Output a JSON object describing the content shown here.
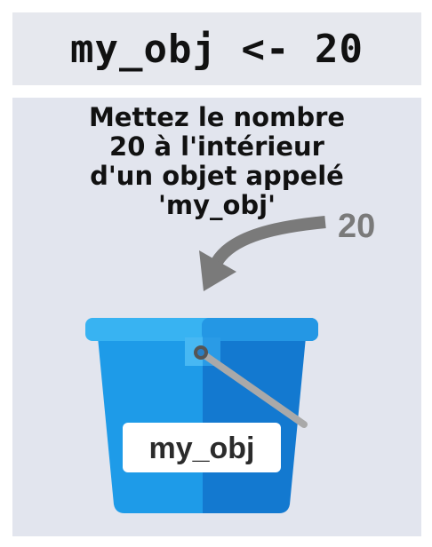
{
  "code": "my_obj <- 20",
  "caption": {
    "line1": "Mettez le nombre",
    "line2": "20 à l'intérieur",
    "line3": "d'un objet appelé",
    "line4": "'my_obj'"
  },
  "arrow_value": "20",
  "bucket_label": "my_obj",
  "colors": {
    "code_bg": "#e6e8ee",
    "panel_bg": "#e2e5ee",
    "arrow": "#7a7a7a",
    "bucket_light": "#1e9be8",
    "bucket_dark": "#1379d0",
    "bucket_rim": "#38b3f2",
    "handle": "#a9a9a9"
  },
  "icons": [
    "curved-arrow-icon",
    "bucket-icon"
  ]
}
